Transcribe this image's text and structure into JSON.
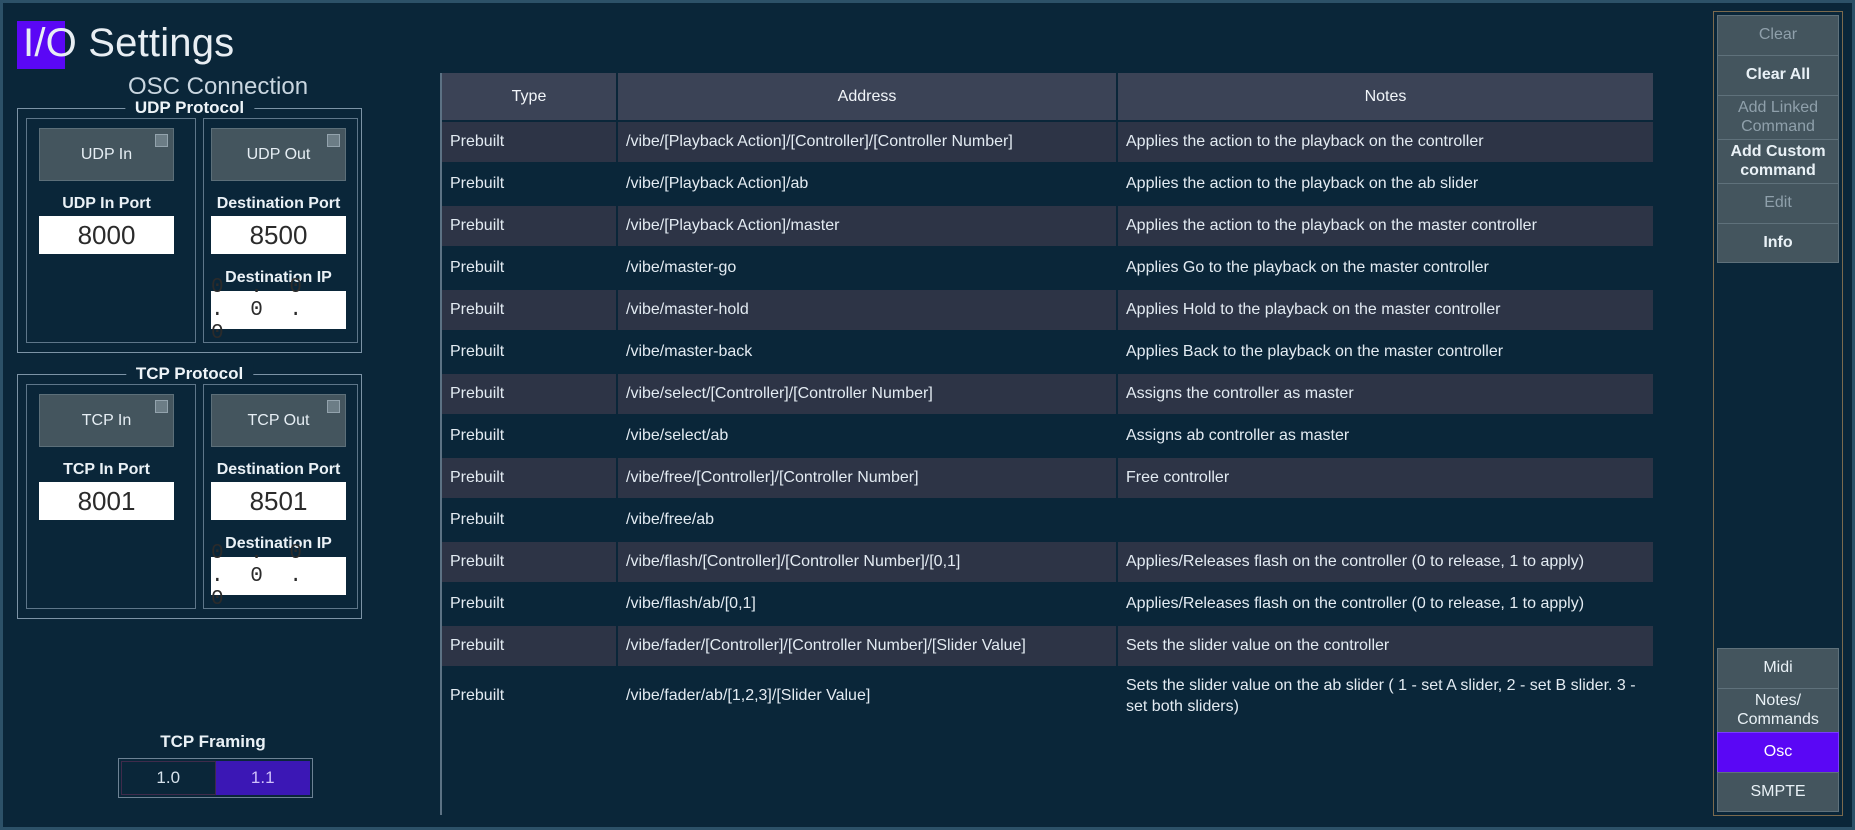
{
  "window": {
    "title": "I/O Settings",
    "accent_color": "#5a07f5",
    "background_color": "#0a2639"
  },
  "osc": {
    "section_label": "OSC Connection",
    "udp": {
      "group_title": "UDP Protocol",
      "in": {
        "toggle_label": "UDP In",
        "port_label": "UDP In Port",
        "port_value": "8000"
      },
      "out": {
        "toggle_label": "UDP Out",
        "port_label": "Destination Port",
        "port_value": "8500",
        "ip_label": "Destination IP",
        "ip_value": "0 . 0 . 0 . 0"
      }
    },
    "tcp": {
      "group_title": "TCP Protocol",
      "in": {
        "toggle_label": "TCP In",
        "port_label": "TCP In Port",
        "port_value": "8001"
      },
      "out": {
        "toggle_label": "TCP Out",
        "port_label": "Destination Port",
        "port_value": "8501",
        "ip_label": "Destination IP",
        "ip_value": "0 . 0 . 0 . 0"
      },
      "framing": {
        "label": "TCP Framing",
        "options": [
          "1.0",
          "1.1"
        ],
        "selected": "1.1"
      }
    }
  },
  "table": {
    "columns": [
      "Type",
      "Address",
      "Notes"
    ],
    "rows": [
      {
        "type": "Prebuilt",
        "address": "/vibe/[Playback Action]/[Controller]/[Controller Number]",
        "notes": "Applies the action to the playback on the controller"
      },
      {
        "type": "Prebuilt",
        "address": "/vibe/[Playback Action]/ab",
        "notes": "Applies the action to the playback on the ab slider"
      },
      {
        "type": "Prebuilt",
        "address": "/vibe/[Playback Action]/master",
        "notes": "Applies the action to the playback on the master controller"
      },
      {
        "type": "Prebuilt",
        "address": "/vibe/master-go",
        "notes": "Applies Go to the playback on the master controller"
      },
      {
        "type": "Prebuilt",
        "address": "/vibe/master-hold",
        "notes": "Applies Hold to the playback on the master controller"
      },
      {
        "type": "Prebuilt",
        "address": "/vibe/master-back",
        "notes": "Applies Back to the playback on the master controller"
      },
      {
        "type": "Prebuilt",
        "address": "/vibe/select/[Controller]/[Controller Number]",
        "notes": "Assigns the controller as master"
      },
      {
        "type": "Prebuilt",
        "address": "/vibe/select/ab",
        "notes": "Assigns ab controller as master"
      },
      {
        "type": "Prebuilt",
        "address": "/vibe/free/[Controller]/[Controller Number]",
        "notes": "Free controller"
      },
      {
        "type": "Prebuilt",
        "address": "/vibe/free/ab",
        "notes": ""
      },
      {
        "type": "Prebuilt",
        "address": "/vibe/flash/[Controller]/[Controller Number]/[0,1]",
        "notes": "Applies/Releases flash on the controller (0 to release, 1 to apply)"
      },
      {
        "type": "Prebuilt",
        "address": "/vibe/flash/ab/[0,1]",
        "notes": "Applies/Releases flash on the controller (0 to release, 1 to apply)"
      },
      {
        "type": "Prebuilt",
        "address": "/vibe/fader/[Controller]/[Controller Number]/[Slider Value]",
        "notes": "Sets the slider value on the controller"
      },
      {
        "type": "Prebuilt",
        "address": "/vibe/fader/ab/[1,2,3]/[Slider Value]",
        "notes": "Sets the slider value on the ab slider ( 1 - set A slider, 2 - set B slider. 3 - set both sliders)"
      }
    ]
  },
  "sidebar": {
    "top_buttons": [
      {
        "label": "Clear",
        "state": "disabled"
      },
      {
        "label": "Clear All",
        "state": "enabled"
      },
      {
        "label": "Add Linked Command",
        "state": "disabled"
      },
      {
        "label": "Add Custom command",
        "state": "enabled"
      },
      {
        "label": "Edit",
        "state": "disabled"
      },
      {
        "label": "Info",
        "state": "enabled"
      }
    ],
    "bottom_buttons": [
      {
        "label": "Midi",
        "state": "enabled"
      },
      {
        "label": "Notes/ Commands",
        "state": "enabled"
      },
      {
        "label": "Osc",
        "state": "selected"
      },
      {
        "label": "SMPTE",
        "state": "enabled"
      }
    ]
  }
}
